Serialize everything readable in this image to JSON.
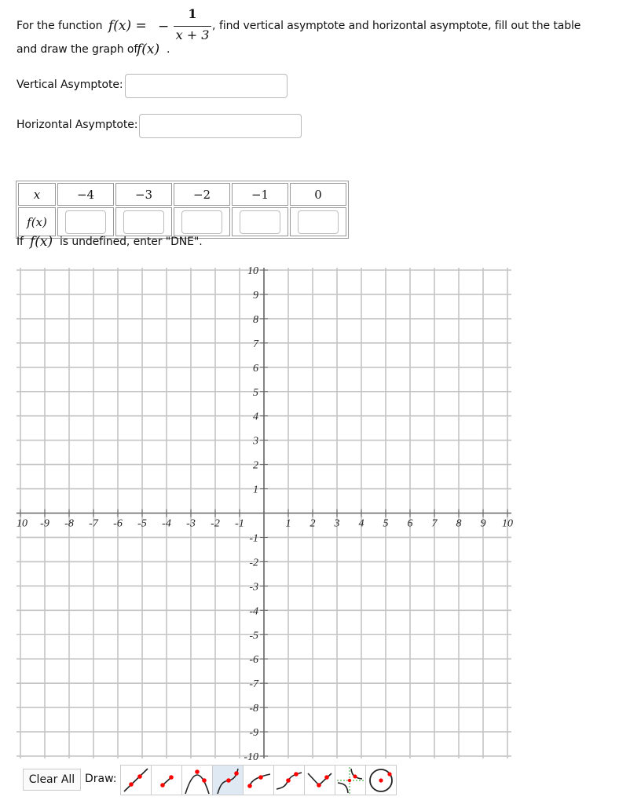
{
  "question": {
    "intro": "For the function",
    "function_lhs": "f(x) =",
    "minus": "−",
    "numerator": "1",
    "denominator": "x + 3",
    "comma": ",",
    "instruction": "find vertical asymptote and horizontal asymptote, fill out the table",
    "line2_prefix": "and draw the graph of",
    "line2_func": "f(x)",
    "line2_suffix": "."
  },
  "fields": {
    "vertical_label": "Vertical Asymptote:",
    "vertical_value": "",
    "horizontal_label": "Horizontal Asymptote:",
    "horizontal_value": ""
  },
  "table": {
    "x_header": "x",
    "fx_header": "f(x)",
    "x_values": [
      "−4",
      "−3",
      "−2",
      "−1",
      "0"
    ],
    "fx_values": [
      "",
      "",
      "",
      "",
      ""
    ]
  },
  "note": {
    "prefix": "If",
    "func": "f(x)",
    "suffix": "is undefined, enter \"DNE\"."
  },
  "graph": {
    "x_range": [
      -10,
      10
    ],
    "y_range": [
      -10,
      10
    ],
    "x_tick_labels": [
      "10",
      "-9",
      "-8",
      "-7",
      "-6",
      "-5",
      "-4",
      "-3",
      "-2",
      "-1",
      "1",
      "2",
      "3",
      "4",
      "5",
      "6",
      "7",
      "8",
      "9",
      "10"
    ],
    "y_tick_labels": [
      "10",
      "9",
      "8",
      "7",
      "6",
      "5",
      "4",
      "3",
      "2",
      "1",
      "-1",
      "-2",
      "-3",
      "-4",
      "-5",
      "-6",
      "-7",
      "-8",
      "-9",
      "-10"
    ]
  },
  "toolbar": {
    "clear_label": "Clear All",
    "draw_label": "Draw:",
    "tools": [
      {
        "name": "line",
        "icon": "line-icon"
      },
      {
        "name": "segment",
        "icon": "segment-icon"
      },
      {
        "name": "parabola",
        "icon": "parabola-icon"
      },
      {
        "name": "cubic",
        "icon": "cubic-icon",
        "selected": true
      },
      {
        "name": "sqrt",
        "icon": "sqrt-icon"
      },
      {
        "name": "cuberoot",
        "icon": "cuberoot-icon"
      },
      {
        "name": "absolute",
        "icon": "absolute-value-icon"
      },
      {
        "name": "rational",
        "icon": "rational-icon"
      },
      {
        "name": "circle",
        "icon": "circle-icon"
      }
    ]
  }
}
